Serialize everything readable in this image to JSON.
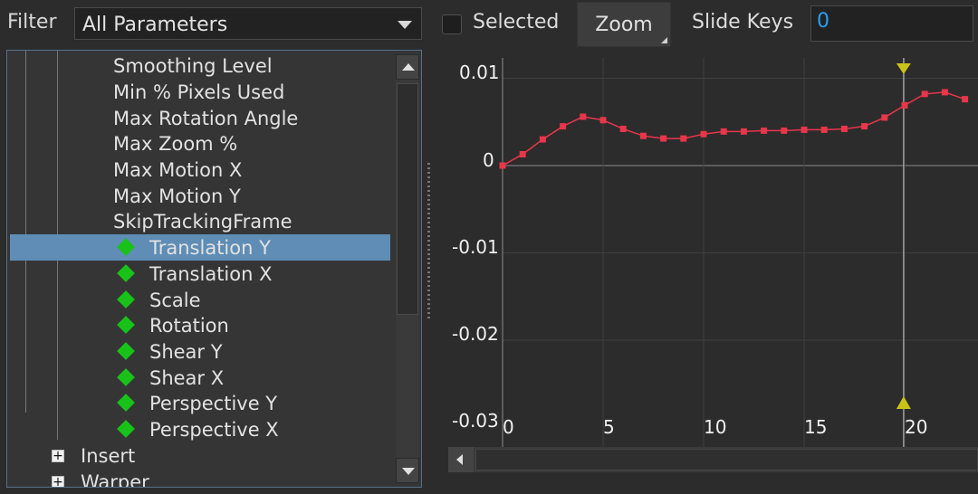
{
  "toolbar": {
    "filter_label": "Filter",
    "filter_value": "All Parameters",
    "selected_label": "Selected",
    "selected_checked": false,
    "zoom_label": "Zoom",
    "slide_keys_label": "Slide Keys",
    "slide_keys_value": "0"
  },
  "tree": {
    "params": [
      "Smoothing Level",
      "Min % Pixels Used",
      "Max Rotation Angle",
      "Max Zoom %",
      "Max Motion X",
      "Max Motion Y",
      "SkipTrackingFrame"
    ],
    "keyed": [
      "Translation Y",
      "Translation X",
      "Scale",
      "Rotation",
      "Shear Y",
      "Shear X",
      "Perspective Y",
      "Perspective X"
    ],
    "selected": "Translation Y",
    "groups": [
      "Insert",
      "Warper"
    ],
    "expander_symbol": "+"
  },
  "graph": {
    "y_ticks": [
      "0.01",
      "0",
      "-0.01",
      "-0.02",
      "-0.03"
    ],
    "x_ticks": [
      "0",
      "5",
      "10",
      "15",
      "20"
    ],
    "playhead_frame": 20,
    "curve_color": "#e8364a",
    "playhead_color": "#c9c219"
  },
  "chart_data": {
    "type": "line",
    "x": [
      0,
      1,
      2,
      3,
      4,
      5,
      6,
      7,
      8,
      9,
      10,
      11,
      12,
      13,
      14,
      15,
      16,
      17,
      18,
      19,
      20,
      21,
      22,
      23
    ],
    "series": [
      {
        "values": [
          0.0,
          0.0013,
          0.003,
          0.0045,
          0.0056,
          0.0052,
          0.0042,
          0.0034,
          0.0031,
          0.0031,
          0.0036,
          0.0039,
          0.0039,
          0.004,
          0.004,
          0.0041,
          0.0041,
          0.0042,
          0.0045,
          0.0055,
          0.0069,
          0.0082,
          0.0084,
          0.0076
        ]
      }
    ],
    "xlim": [
      0,
      23
    ],
    "ylim": [
      -0.03,
      0.01
    ],
    "grid": true
  }
}
